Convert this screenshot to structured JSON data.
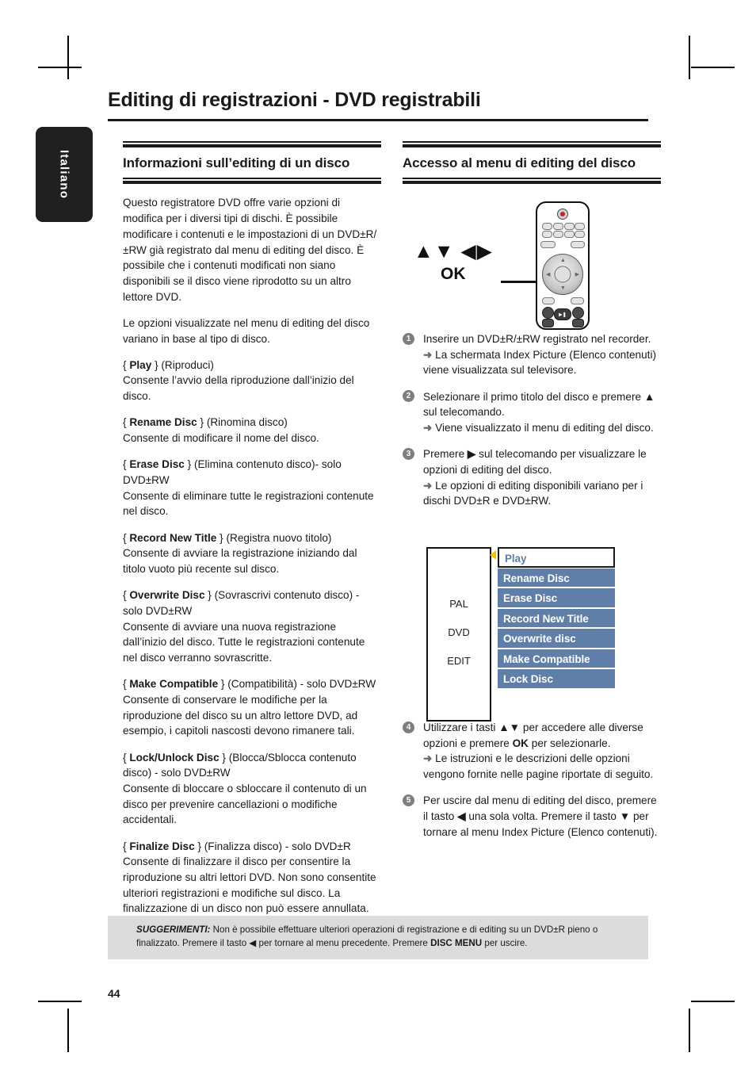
{
  "page": {
    "title": "Editing di registrazioni - DVD registrabili",
    "language_tab": "Italiano",
    "number": "44"
  },
  "left_column": {
    "heading": "Informazioni sull’editing di un disco",
    "paragraphs": [
      "Questo registratore DVD offre varie opzioni di modifica per i diversi tipi di dischi. È possibile modificare i contenuti e le impostazioni di un DVD±R/±RW già registrato dal menu di editing del disco. È possibile che i contenuti modificati non siano disponibili se il disco viene riprodotto su un altro lettore DVD.",
      "Le opzioni visualizzate nel menu di editing del disco variano in base al tipo di disco."
    ],
    "options": [
      {
        "open_brace": "{",
        "name": "Play",
        "close_brace": "}",
        "translation": "(Riproduci)",
        "description": "Consente l’avvio della riproduzione dall’inizio del disco."
      },
      {
        "open_brace": "{",
        "name": "Rename Disc",
        "close_brace": "}",
        "translation": "(Rinomina disco)",
        "description": "Consente di modificare il nome del disco."
      },
      {
        "open_brace": "{",
        "name": "Erase Disc",
        "close_brace": "}",
        "translation": "(Elimina contenuto disco)- solo DVD±RW",
        "description": "Consente di eliminare tutte le registrazioni contenute nel disco."
      },
      {
        "open_brace": "{",
        "name": "Record New Title",
        "close_brace": "}",
        "translation": "(Registra nuovo titolo)",
        "description": "Consente di avviare la registrazione iniziando dal titolo vuoto più recente sul disco."
      },
      {
        "open_brace": "{",
        "name": "Overwrite Disc",
        "close_brace": "}",
        "translation": "(Sovrascrivi contenuto disco) - solo DVD±RW",
        "description": "Consente di avviare una nuova registrazione dall’inizio del disco. Tutte le registrazioni contenute nel disco verranno sovrascritte."
      },
      {
        "open_brace": "{",
        "name": "Make Compatible",
        "close_brace": "}",
        "translation": "(Compatibilità) - solo DVD±RW",
        "description": "Consente di conservare le modifiche per la riproduzione del disco su un altro lettore DVD, ad esempio, i capitoli nascosti devono rimanere tali."
      },
      {
        "open_brace": "{",
        "name": "Lock/Unlock Disc",
        "close_brace": "}",
        "translation": "(Blocca/Sblocca contenuto disco) - solo DVD±RW",
        "description": "Consente di bloccare o sbloccare il contenuto di un disco per prevenire cancellazioni o modifiche accidentali."
      },
      {
        "open_brace": "{",
        "name": "Finalize Disc",
        "close_brace": "}",
        "translation": "(Finalizza disco) - solo DVD±R",
        "description": "Consente di finalizzare il disco per consentire la riproduzione su altri lettori DVD. Non sono consentite ulteriori registrazioni e modifiche sul disco. La finalizzazione di un disco non può essere annullata."
      }
    ]
  },
  "right_column": {
    "heading": "Accesso al menu di editing del disco",
    "remote": {
      "arrow_glyphs": "▲▼ ◀▶",
      "ok_label": "OK"
    },
    "steps": [
      {
        "num": "1",
        "main": "Inserire un DVD±R/±RW registrato nel recorder.",
        "result": "La schermata Index Picture (Elenco contenuti) viene visualizzata sul televisore."
      },
      {
        "num": "2",
        "main_pre": "Selezionare il primo titolo del disco e premere ",
        "key": "▲",
        "main_post": " sul telecomando.",
        "result": "Viene visualizzato il menu di editing del disco."
      },
      {
        "num": "3",
        "main_pre": "Premere ",
        "key": "▶",
        "main_post": " sul telecomando per visualizzare le opzioni di editing del disco.",
        "result": "Le opzioni di editing disponibili variano per i dischi DVD±R e DVD±RW."
      }
    ],
    "steps2": [
      {
        "num": "4",
        "main_pre": " Utilizzare i tasti ",
        "key": "▲▼",
        "main_mid": " per accedere alle diverse opzioni e premere ",
        "key2": "OK",
        "main_post": " per selezionarle.",
        "result": "Le istruzioni e le descrizioni delle opzioni vengono fornite nelle pagine riportate di seguito."
      },
      {
        "num": "5",
        "main_pre": "Per uscire dal menu di editing del disco, premere il tasto ",
        "key": "◀",
        "main_mid": " una sola volta. Premere il tasto ",
        "key2": "▼",
        "main_post": " per tornare al menu Index Picture (Elenco contenuti)."
      }
    ],
    "menu_diagram": {
      "status_lines": [
        "PAL",
        "DVD",
        "EDIT"
      ],
      "cursor_icon": "left-triangle-cursor",
      "items": [
        {
          "label": "Play",
          "selected": true
        },
        {
          "label": "Rename Disc",
          "selected": false
        },
        {
          "label": "Erase Disc",
          "selected": false
        },
        {
          "label": "Record New Title",
          "selected": false
        },
        {
          "label": "Overwrite disc",
          "selected": false
        },
        {
          "label": "Make Compatible",
          "selected": false
        },
        {
          "label": "Lock Disc",
          "selected": false
        }
      ],
      "colors": {
        "item_bg": "#5f7fa8",
        "item_text": "#ffffff",
        "cursor": "#f2c300"
      }
    },
    "arrow_marker": "➜"
  },
  "tips": {
    "label": "SUGGERIMENTI:",
    "text_1": " Non è possibile effettuare ulteriori operazioni di registrazione e di editing su un DVD±R pieno o finalizzato. Premere il tasto ",
    "key": "◀",
    "text_2": " per tornare al menu precedente. Premere ",
    "bold_key": "DISC MENU",
    "text_3": " per uscire."
  }
}
